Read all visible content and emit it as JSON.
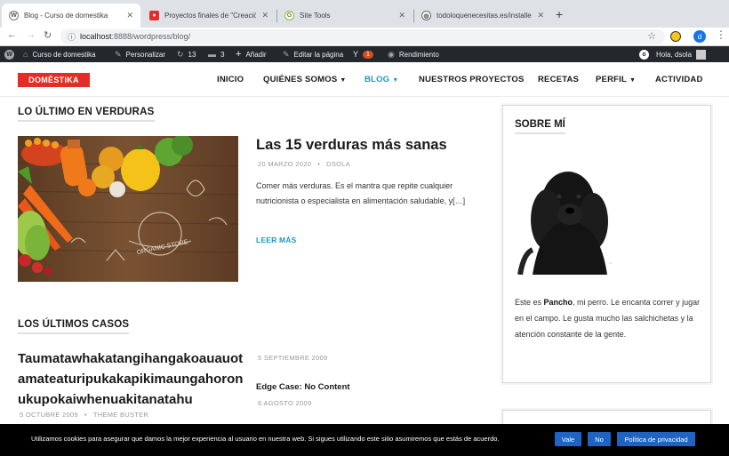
{
  "browser": {
    "tabs": [
      {
        "title": "Blog - Curso de domestika",
        "active": true
      },
      {
        "title": "Proyectos finales de \"Creación d",
        "active": false
      },
      {
        "title": "Site Tools",
        "active": false
      },
      {
        "title": "todoloquenecesitas.es/installer.p",
        "active": false
      }
    ],
    "url_host": "localhost",
    "url_path": ":8888/wordpress/blog/",
    "profile_initial": "d"
  },
  "adminbar": {
    "site_name": "Curso de domestika",
    "customize": "Personalizar",
    "updates": "13",
    "comments": "3",
    "add_new": "Añadir",
    "edit_page": "Editar la página",
    "yoast_count": "1",
    "performance": "Rendimiento",
    "greeting": "Hola, dsola"
  },
  "header": {
    "logo": "DOMĒSTIKA",
    "nav": {
      "inicio": "INICIO",
      "quienes": "QUIÉNES SOMOS",
      "blog": "BLOG",
      "proyectos": "NUESTROS PROYECTOS",
      "recetas": "RECETAS",
      "perfil": "PERFIL",
      "actividad": "ACTIVIDAD"
    }
  },
  "main": {
    "section1_title": "LO ÚLTIMO EN VERDURAS",
    "featured": {
      "title": "Las 15 verduras más sanas",
      "date": "20 MARZO 2020",
      "author": "DSOLA",
      "excerpt": "Comer más verduras. Es el mantra que repite cualquier nutricionista o especialista en alimentación saludable, y[…]",
      "read_more": "LEER MÁS",
      "image_label": "ORGANIC STORE"
    },
    "section2_title": "LOS ÚLTIMOS CASOS",
    "cases": {
      "long_title": "Taumatawhakatangihangakoauauotamateaturipukakapikimaungahoronukupokaiwhenuakitanatahu",
      "long_date": "5 OCTUBRE 2009",
      "long_author": "THEME BUSTER",
      "date_a": "5 SEPTIEMBRE 2009",
      "case_b_title": "Edge Case: No Content",
      "date_b": "6 AGOSTO 2009"
    }
  },
  "sidebar": {
    "widget_title": "SOBRE MÍ",
    "bio_pre": "Este es ",
    "bio_name": "Pancho",
    "bio_post": ", mi perro. Le encanta correr y jugar en el campo. Le gusta mucho las salchichetas y la atención constante de la gente."
  },
  "cookies": {
    "text": "Utilizamos cookies para asegurar que damos la mejor experiencia al usuario en nuestra web. Si sigues utilizando este sitio asumiremos que estás de acuerdo.",
    "accept": "Vale",
    "reject": "No",
    "policy": "Política de privacidad"
  },
  "colors": {
    "accent": "#2196c4",
    "logo_bg": "#e52d27",
    "adminbar_bg": "#23282d",
    "button_bg": "#1f64c2"
  }
}
